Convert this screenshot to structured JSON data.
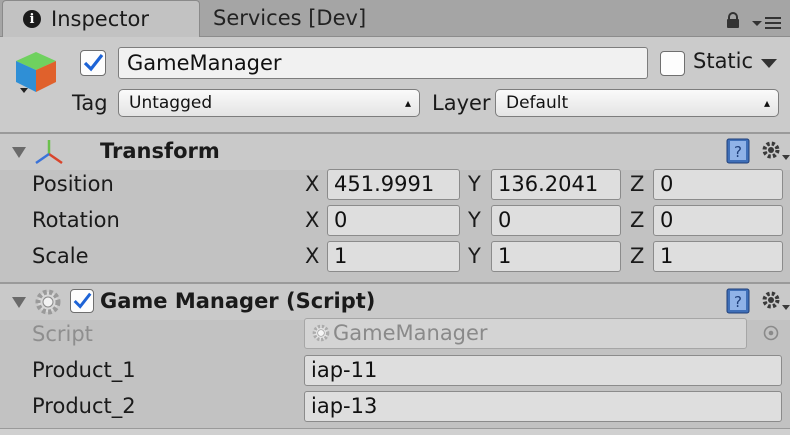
{
  "tabs": [
    {
      "label": "Inspector",
      "active": true
    },
    {
      "label": "Services [Dev]",
      "active": false
    }
  ],
  "header": {
    "name": "GameManager",
    "active": true,
    "static_label": "Static",
    "static_checked": false,
    "tag_label": "Tag",
    "tag_value": "Untagged",
    "layer_label": "Layer",
    "layer_value": "Default"
  },
  "transform": {
    "title": "Transform",
    "rows": [
      {
        "label": "Position",
        "x": "451.9991",
        "y": "136.2041",
        "z": "0"
      },
      {
        "label": "Rotation",
        "x": "0",
        "y": "0",
        "z": "0"
      },
      {
        "label": "Scale",
        "x": "1",
        "y": "1",
        "z": "1"
      }
    ],
    "axes": [
      "X",
      "Y",
      "Z"
    ]
  },
  "game_manager": {
    "title": "Game Manager (Script)",
    "enabled": true,
    "script_label": "Script",
    "script_value": "GameManager",
    "fields": [
      {
        "label": "Product_1",
        "value": "iap-11"
      },
      {
        "label": "Product_2",
        "value": "iap-13"
      }
    ]
  },
  "icons": [
    "info-icon",
    "lock-icon",
    "menu-icon",
    "gameobject-cube-icon",
    "dropdown-arrow-icon",
    "transform-axes-icon",
    "help-book-icon",
    "gear-icon",
    "script-gear-icon",
    "object-picker-icon"
  ],
  "colors": {
    "panel": "#c2c2c2",
    "tab_bar": "#a5a5a5",
    "header": "#cbcbcb",
    "check_blue": "#1d63d6"
  }
}
